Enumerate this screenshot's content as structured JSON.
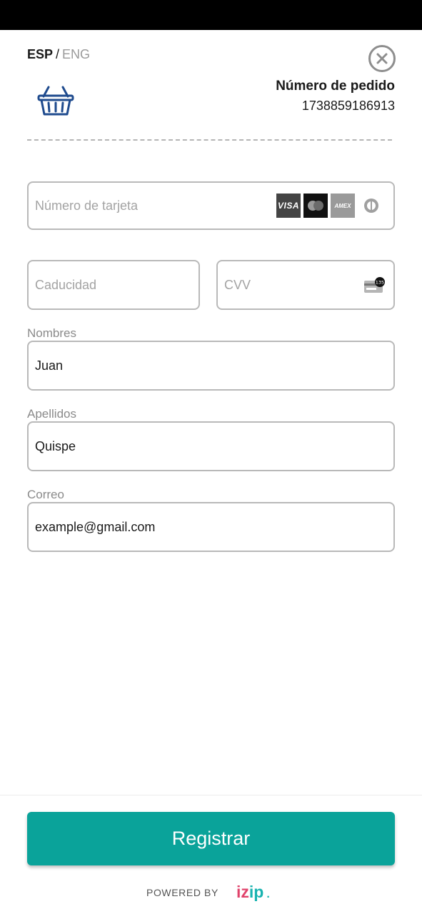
{
  "language": {
    "active": "ESP",
    "separator": "/",
    "inactive": "ENG"
  },
  "order": {
    "label": "Número de pedido",
    "number": "1738859186913"
  },
  "card": {
    "number_placeholder": "Número de tarjeta",
    "brands": [
      "VISA",
      "AMEX"
    ],
    "expiry_placeholder": "Caducidad",
    "cvv_placeholder": "CVV",
    "cvv_icon_text": "135"
  },
  "fields": {
    "name_label": "Nombres",
    "name_value": "Juan",
    "lastname_label": "Apellidos",
    "lastname_value": "Quispe",
    "email_label": "Correo",
    "email_value": "example@gmail.com"
  },
  "submit_label": "Registrar",
  "footer": {
    "powered_by": "POWERED BY",
    "logo_part1": "iz",
    "logo_part2": "ip",
    "logo_dot": "."
  },
  "colors": {
    "accent": "#0aa39a",
    "basket": "#1f4b8e",
    "logo_pink": "#e0436b",
    "logo_teal": "#19b3b0"
  }
}
